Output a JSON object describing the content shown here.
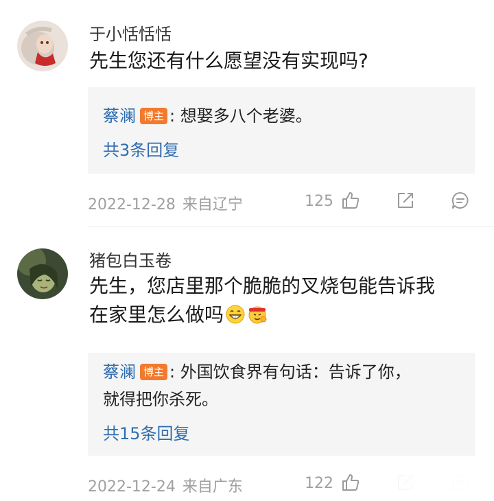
{
  "comments": [
    {
      "username": "于小恬恬恬",
      "text": "先生您还有什么愿望没有实现吗?",
      "reply": {
        "author": "蔡澜",
        "badge": "博主",
        "text": ": 想娶多八个老婆。"
      },
      "more_replies": "共3条回复",
      "date": "2022-12-28",
      "location": "来自辽宁",
      "likes": "125",
      "icons": [
        "thumbs-up-icon",
        "share-icon",
        "comment-icon"
      ]
    },
    {
      "username": "猪包白玉卷",
      "text_line1": "先生，您店里那个脆脆的叉烧包能告诉我",
      "text_line2": "在家里怎么做吗",
      "emojis": [
        "grinning-emoji",
        "fighting-emoji"
      ],
      "reply": {
        "author": "蔡澜",
        "badge": "博主",
        "text_line1": ": 外国饮食界有句话：告诉了你，",
        "text_line2": "就得把你杀死。"
      },
      "more_replies": "共15条回复",
      "date": "2022-12-24",
      "location": "来自广东",
      "likes": "122",
      "icons": [
        "thumbs-up-icon",
        "share-icon",
        "comment-icon"
      ]
    }
  ],
  "colors": {
    "link_blue": "#2f6db0",
    "badge_orange": "#f27a2e",
    "meta_gray": "#a0a0a0",
    "reply_bg": "#f5f5f5"
  }
}
